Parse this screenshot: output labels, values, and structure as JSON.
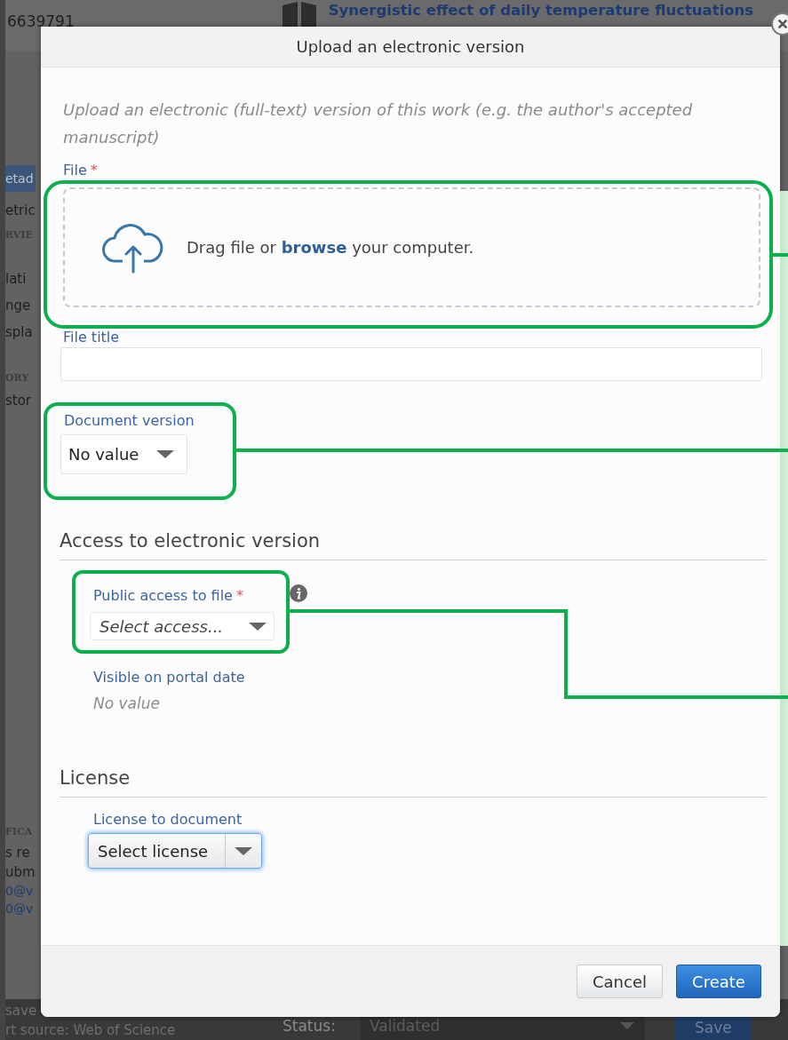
{
  "background_page": {
    "record_id": "6639791",
    "record_title": "Synergistic effect of daily temperature fluctuations",
    "sidebar_fragments": [
      {
        "text": "etad",
        "kind": "tab"
      },
      {
        "text": "etric",
        "kind": "item"
      },
      {
        "text": "RVIE",
        "kind": "heading"
      },
      {
        "text": "lati",
        "kind": "item"
      },
      {
        "text": "nge",
        "kind": "item"
      },
      {
        "text": "spla",
        "kind": "item"
      },
      {
        "text": "ORY",
        "kind": "heading"
      },
      {
        "text": "stor",
        "kind": "item"
      },
      {
        "text": "FICA",
        "kind": "heading"
      },
      {
        "text": "s re",
        "kind": "item"
      },
      {
        "text": "ubm",
        "kind": "item"
      },
      {
        "text": "0@v",
        "kind": "link"
      },
      {
        "text": "0@v",
        "kind": "link"
      }
    ],
    "bottom_bar": {
      "left_lines": [
        "save",
        "rt source: Web of Science"
      ],
      "status_label": "Status:",
      "status_value": "Validated",
      "save_button": "Save"
    }
  },
  "dialog": {
    "title": "Upload an electronic version",
    "intro": "Upload an electronic (full-text) version of this work (e.g. the author's accepted manuscript)",
    "file": {
      "label": "File",
      "required_mark": "*",
      "drop_text_before": "Drag file or",
      "browse_link": "browse",
      "drop_text_after": "your computer."
    },
    "file_title": {
      "label": "File title"
    },
    "document_version": {
      "label": "Document version",
      "value": "No value"
    },
    "access_section": {
      "heading": "Access to electronic version",
      "public_access": {
        "label": "Public access to file",
        "required_mark": "*",
        "placeholder": "Select access..."
      },
      "visible_date": {
        "label": "Visible on portal date",
        "value": "No value"
      }
    },
    "license_section": {
      "heading": "License",
      "license": {
        "label": "License to document",
        "value": "Select license",
        "focused": true
      }
    },
    "buttons": [
      {
        "label": "Cancel",
        "kind": "secondary"
      },
      {
        "label": "Create",
        "kind": "primary"
      }
    ]
  }
}
